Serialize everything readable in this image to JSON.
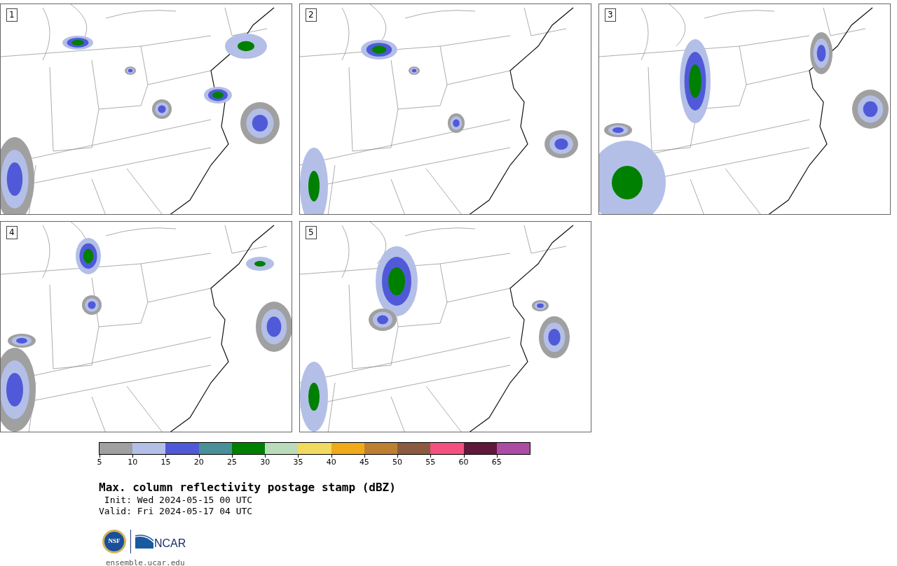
{
  "panels": [
    {
      "number": "1"
    },
    {
      "number": "2"
    },
    {
      "number": "3"
    },
    {
      "number": "4"
    },
    {
      "number": "5"
    }
  ],
  "colorbar": {
    "segments": [
      {
        "color": "#a0a0a0"
      },
      {
        "color": "#b4bfe8"
      },
      {
        "color": "#505ad8"
      },
      {
        "color": "#4a9098"
      },
      {
        "color": "#008000"
      },
      {
        "color": "#badcba"
      },
      {
        "color": "#f0da60"
      },
      {
        "color": "#f0aa18"
      },
      {
        "color": "#bc8030"
      },
      {
        "color": "#8c5a40"
      },
      {
        "color": "#f45080"
      },
      {
        "color": "#621838"
      },
      {
        "color": "#ac4ca4"
      }
    ],
    "ticks": [
      "5",
      "10",
      "15",
      "20",
      "25",
      "30",
      "35",
      "40",
      "45",
      "50",
      "55",
      "60",
      "65"
    ]
  },
  "title": "Max. column reflectivity postage stamp (dBZ)",
  "init": " Init: Wed 2024-05-15 00 UTC",
  "valid": "Valid: Fri 2024-05-17 04 UTC",
  "logos": {
    "nsf": "NSF",
    "ncar": "NCAR"
  },
  "url": "ensemble.ucar.edu"
}
